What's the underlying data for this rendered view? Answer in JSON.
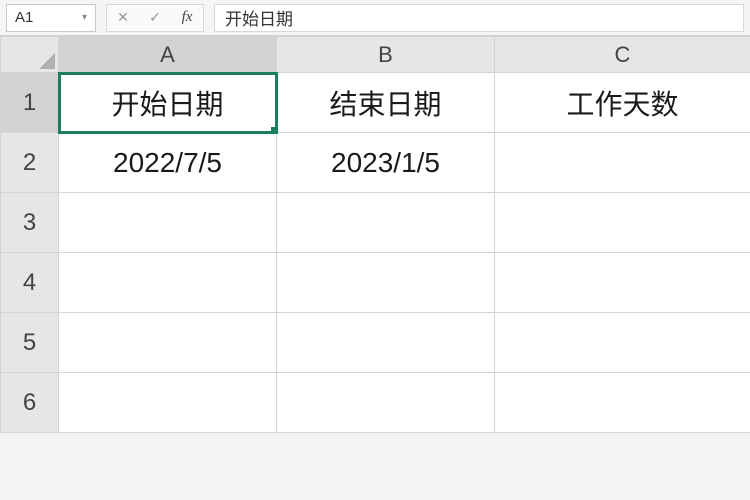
{
  "formula_bar": {
    "name_box": "A1",
    "cancel_icon": "✕",
    "confirm_icon": "✓",
    "fx_label": "fx",
    "formula_value": "开始日期"
  },
  "columns": [
    "A",
    "B",
    "C"
  ],
  "rows": [
    "1",
    "2",
    "3",
    "4",
    "5",
    "6"
  ],
  "active_cell": "A1",
  "cells": {
    "A1": "开始日期",
    "B1": "结束日期",
    "C1": "工作天数",
    "A2": "2022/7/5",
    "B2": "2023/1/5",
    "C2": "",
    "A3": "",
    "B3": "",
    "C3": "",
    "A4": "",
    "B4": "",
    "C4": "",
    "A5": "",
    "B5": "",
    "C5": "",
    "A6": "",
    "B6": "",
    "C6": ""
  }
}
